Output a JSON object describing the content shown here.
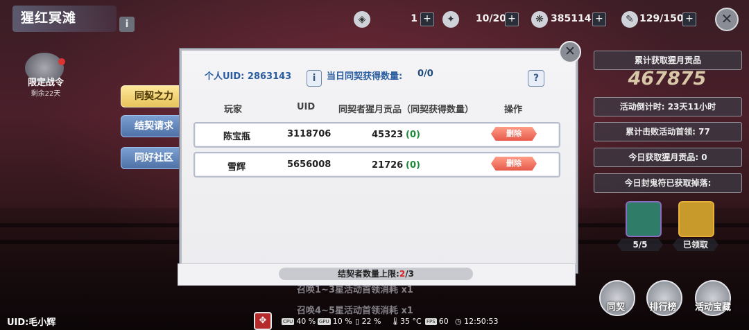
{
  "header": {
    "title": "猩红冥滩",
    "info_icon": "i",
    "resources": [
      {
        "icon": "ticket-icon",
        "value": "1"
      },
      {
        "icon": "stamina-icon",
        "value": "10/20"
      },
      {
        "icon": "currency-icon",
        "value": "385114"
      },
      {
        "icon": "feather-icon",
        "value": "129/150"
      }
    ],
    "plus": "+",
    "close": "✕"
  },
  "left": {
    "war_pass_label": "限定战令",
    "war_pass_sub": "剩余22天",
    "tabs": [
      "同契之力",
      "结契请求",
      "同好社区"
    ],
    "active_tab": 0
  },
  "dialog": {
    "close": "✕",
    "uid_label": "个人UID: 2863143",
    "info_btn": "i",
    "today_label": "当日同契获得数量:",
    "today_count": "0/0",
    "help_btn": "?",
    "columns": [
      "玩家",
      "UID",
      "同契者猩月贡品（同契获得数量）",
      "操作"
    ],
    "rows": [
      {
        "name": "陈宝瓶",
        "uid": "3118706",
        "tribute": "45323",
        "count": "(0)",
        "action": "删除"
      },
      {
        "name": "雪辉",
        "uid": "5656008",
        "tribute": "21726",
        "count": "(0)",
        "action": "删除"
      }
    ],
    "limit_prefix": "结契者数量上限:",
    "limit_current": "2",
    "limit_suffix": "/3"
  },
  "right": {
    "total_label": "累计获取猩月贡品",
    "total_value": "467875",
    "countdown": "活动倒计时: 23天11小时",
    "defeated": "累计击败活动首领: 77",
    "today_tribute": "今日获取猩月贡品: 0",
    "today_drop": "今日封鬼符已获取掉落:",
    "rewards": [
      {
        "label": "5/5",
        "color": "#2f7c69"
      },
      {
        "label": "已领取",
        "color": "#c89a2c"
      }
    ],
    "buttons": [
      "同契",
      "排行榜",
      "活动宝藏"
    ]
  },
  "quests": [
    {
      "text": "召唤1~3星活动首领消耗",
      "mult": "x1"
    },
    {
      "text": "召唤4~5星活动首领消耗",
      "mult": "x1"
    }
  ],
  "status_bar": {
    "uid": "UID:毛小辉",
    "cpu": "40 %",
    "gpu": "10 %",
    "battery": "22 %",
    "temp": "35 °C",
    "fps": "60",
    "time": "12:50:53",
    "cpu_tag": "CPU",
    "gpu_tag": "GPU",
    "fps_tag": "FPS"
  }
}
